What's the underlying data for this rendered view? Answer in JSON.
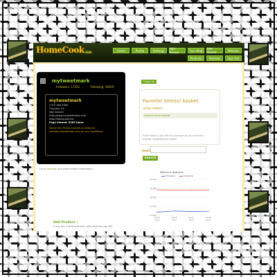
{
  "site": {
    "logo": "HomeCook",
    "logo_tld": ".me",
    "nav_row1": [
      "Home",
      "Profile",
      "Settings",
      "Add Recipe",
      "Your Blog",
      "Add Market",
      "Website"
    ],
    "nav_row2": [
      "Products",
      "Reviews",
      "Sign Out"
    ]
  },
  "profile": {
    "name": "mytweetmark",
    "followers": "Followers: 17222",
    "following": "Following: 16019",
    "username": "mytweetmark",
    "lines": [
      "(707) 565-5494",
      "Concord, CA",
      "Mail Ahmed",
      "http://www.mytweetmark.com",
      "http://homecook.me",
      "Page Viewed: 5285 times"
    ],
    "about": "About me: Please contact us today at hello@mytweetmark.com for any questions!"
  },
  "settings_note": {
    "prefix": "Go to",
    "link": "Settings",
    "suffix": "and enter profile information."
  },
  "follow_button": "Follow Us",
  "favorite": {
    "title": "Favorite item(s) basket",
    "user": "urna.melon",
    "slot": "Favorite items basket",
    "note": "Enter item(s) you like to purchase at your farmers market, separated by space."
  },
  "search": {
    "label": "Search :",
    "button": "search"
  },
  "add_product": {
    "title": "Add Product »",
    "sub": "If you are a farm business, add products you sell."
  },
  "colors": {
    "accent": "#6fa81a",
    "gold": "#c8941a",
    "header": "#1c2a08",
    "site_bg": "#fde9a8"
  },
  "chart_data": {
    "type": "line",
    "title": "Metrics & Analytics",
    "categories": [
      "Jul 03 2017",
      "Jul 10 2017",
      "Jul 17 2017",
      "Jul 24 2017"
    ],
    "ylim": [
      17000,
      19000
    ],
    "yticks": [
      17000,
      17500,
      18000,
      18500,
      19000
    ],
    "ytick_labels": [
      "17,000",
      "17,500",
      "18,000",
      "18,500",
      "19,000"
    ],
    "series": [
      {
        "name": "Followers",
        "color": "#3a6fd4",
        "values": [
          17180,
          17240,
          17210,
          17222
        ]
      },
      {
        "name": "Following",
        "color": "#e0583a",
        "values": [
          18420,
          18400,
          18405,
          18410
        ]
      }
    ],
    "legend": "top"
  }
}
